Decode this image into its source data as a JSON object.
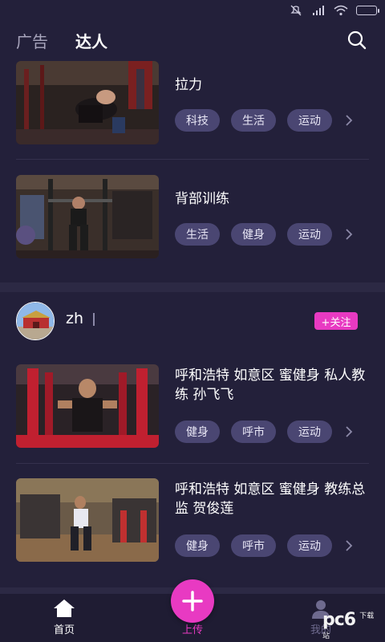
{
  "nav": {
    "tabs": [
      {
        "label": "广告"
      },
      {
        "label": "达人"
      }
    ]
  },
  "feed": {
    "items": [
      {
        "title": "拉力",
        "tags": [
          "科技",
          "生活",
          "运动"
        ]
      },
      {
        "title": "背部训练",
        "tags": [
          "生活",
          "健身",
          "运动"
        ]
      },
      {
        "title": "呼和浩特 如意区 蜜健身 私人教练 孙飞飞",
        "tags": [
          "健身",
          "呼市",
          "运动"
        ]
      },
      {
        "title": "呼和浩特 如意区 蜜健身 教练总监 贺俊莲",
        "tags": [
          "健身",
          "呼市",
          "运动"
        ]
      }
    ],
    "user": {
      "name": "zh",
      "follow_label": "+关注"
    }
  },
  "bottom": {
    "home_label": "首页",
    "upload_label": "上传",
    "me_label": "我的"
  },
  "watermark": {
    "text": "pc6",
    "subtext": "下载站"
  },
  "colors": {
    "background": "#23203a",
    "accent": "#e83ac2",
    "tag_bg": "#4a4672"
  }
}
